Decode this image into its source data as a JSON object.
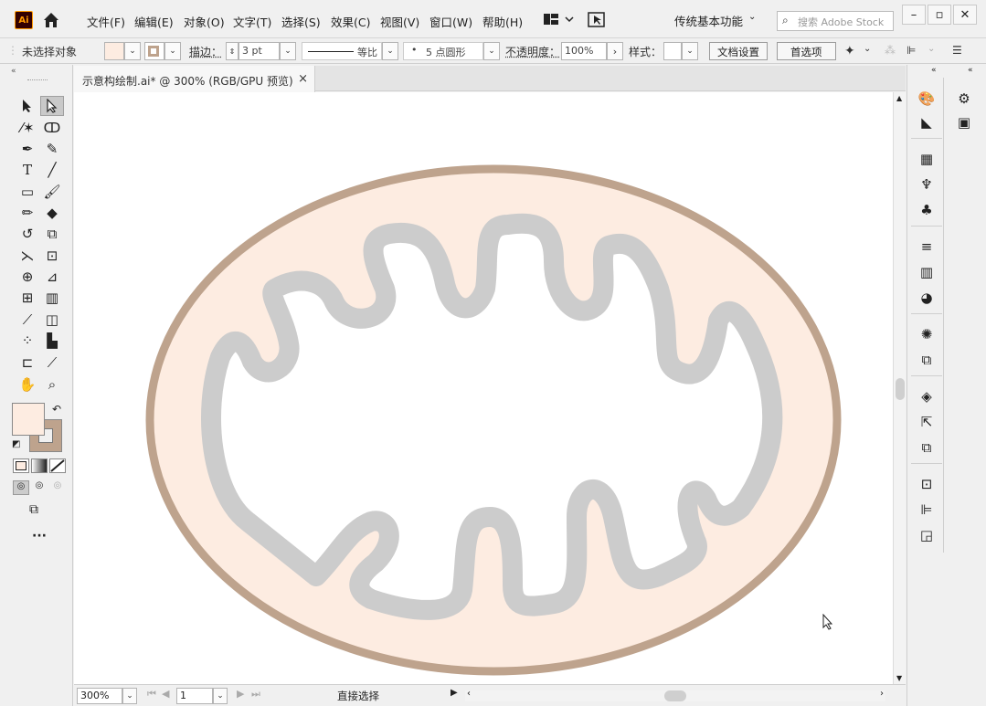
{
  "app": {
    "logo_text": "Ai",
    "menus": [
      "文件(F)",
      "编辑(E)",
      "对象(O)",
      "文字(T)",
      "选择(S)",
      "效果(C)",
      "视图(V)",
      "窗口(W)",
      "帮助(H)"
    ],
    "workspace": "传统基本功能",
    "search_placeholder": "搜索 Adobe Stock"
  },
  "control_bar": {
    "selection_label": "未选择对象",
    "stroke_label": "描边：",
    "stroke_value": "3 pt",
    "stroke_style": "等比",
    "brush_label": "5 点圆形",
    "opacity_label": "不透明度：",
    "opacity_value": "100%",
    "style_label": "样式：",
    "doc_setup_button": "文档设置",
    "prefs_button": "首选项"
  },
  "document": {
    "tab_title": "示意构绘制.ai* @ 300% (RGB/GPU 预览)",
    "close": "×"
  },
  "status": {
    "zoom": "300%",
    "artboard": "1",
    "tool_name": "直接选择"
  },
  "colors": {
    "fill": "#fdece1",
    "stroke": "#bea38d",
    "outer_membrane": "#bea38d",
    "membrane_fill": "#fdece1",
    "inner_membrane": "#cccccc",
    "canvas": "#ffffff"
  },
  "tools": [
    "selection-tool",
    "direct-selection-tool",
    "magic-wand-tool",
    "lasso-tool",
    "pen-tool",
    "curvature-tool",
    "type-tool",
    "line-tool",
    "rectangle-tool",
    "paintbrush-tool",
    "pencil-tool",
    "eraser-tool",
    "rotate-tool",
    "scale-tool",
    "width-tool",
    "free-transform-tool",
    "shape-builder-tool",
    "perspective-grid-tool",
    "mesh-tool",
    "gradient-tool",
    "eyedropper-tool",
    "blend-tool",
    "symbol-sprayer-tool",
    "column-graph-tool",
    "artboard-tool",
    "slice-tool",
    "hand-tool",
    "zoom-tool"
  ],
  "right_panels": [
    "color-icon",
    "color-guide-icon",
    "swatches-icon",
    "brushes-icon",
    "symbols-icon",
    "stroke-icon",
    "gradient-icon",
    "transparency-icon",
    "appearance-icon",
    "graphic-styles-icon",
    "layers-icon",
    "export-icon",
    "artboards-icon",
    "transform-icon",
    "align-icon",
    "pathfinder-icon"
  ]
}
